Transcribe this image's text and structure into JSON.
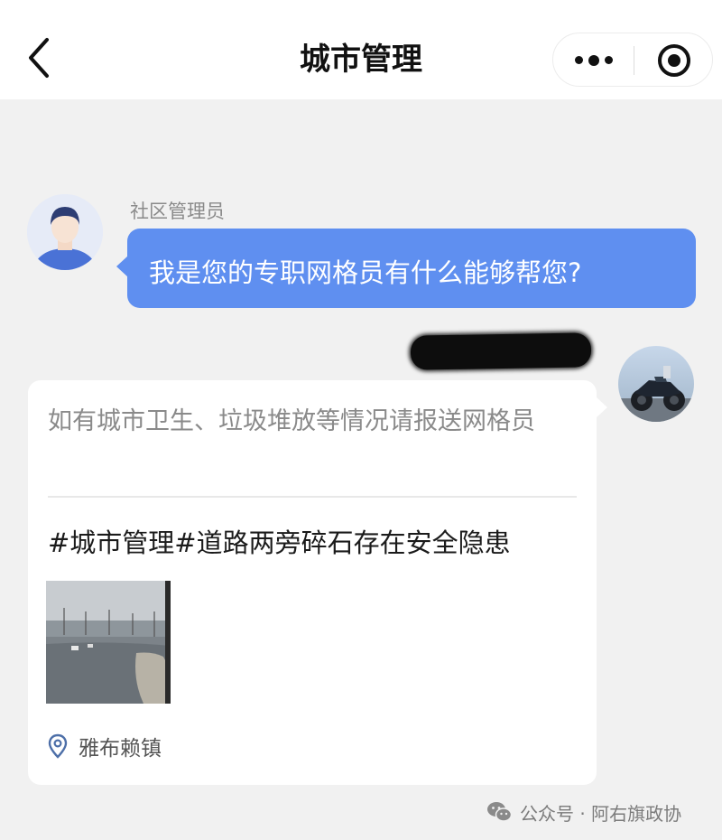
{
  "header": {
    "title": "城市管理",
    "back_icon": "chevron-left-icon",
    "more_icon": "more-dots-icon",
    "close_icon": "target-close-icon"
  },
  "chat": {
    "admin": {
      "name": "社区管理员",
      "message": "我是您的专职网格员有什么能够帮您?",
      "avatar": "user-avatar-icon"
    },
    "user": {
      "avatar": "motorcycle-photo-avatar"
    },
    "card": {
      "hint": "如有城市卫生、垃圾堆放等情况请报送网格员",
      "topic": "#城市管理#道路两旁碎石存在安全隐患",
      "photo": "road-photo",
      "location": "雅布赖镇",
      "location_icon": "location-pin-icon"
    }
  },
  "watermark": {
    "text": "公众号 · 阿右旗政协",
    "icon": "wechat-icon"
  },
  "colors": {
    "bubble": "#5f8ff0",
    "background": "#f1f1f1",
    "card": "#ffffff"
  }
}
